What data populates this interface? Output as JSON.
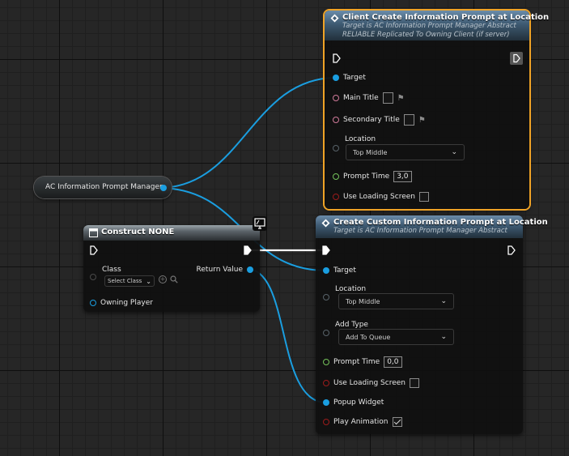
{
  "colors": {
    "object_pin": "#1a9ee0",
    "exec": "#ffffff",
    "selection": "#f0a326",
    "text_pin": "#d07a9a",
    "float_pin": "#74c25a",
    "bool_pin": "#9b1b1b"
  },
  "variable_node": {
    "label": "AC Information Prompt Manager"
  },
  "client_node": {
    "title": "Client Create Information Prompt at Location",
    "subtitle1": "Target is AC Information Prompt Manager Abstract",
    "subtitle2": "RELIABLE Replicated To Owning Client (if server)",
    "pins": {
      "target": "Target",
      "main_title": "Main Title",
      "secondary_title": "Secondary Title",
      "location": "Location",
      "location_value": "Top Middle",
      "prompt_time": "Prompt Time",
      "prompt_time_value": "3,0",
      "use_loading_screen": "Use Loading Screen"
    }
  },
  "construct_node": {
    "title": "Construct NONE",
    "pins": {
      "class": "Class",
      "class_placeholder": "Select Class",
      "return_value": "Return Value",
      "owning_player": "Owning Player"
    }
  },
  "custom_node": {
    "title": "Create Custom Information Prompt at Location",
    "subtitle": "Target is AC Information Prompt Manager Abstract",
    "pins": {
      "target": "Target",
      "location": "Location",
      "location_value": "Top Middle",
      "add_type": "Add Type",
      "add_type_value": "Add To Queue",
      "prompt_time": "Prompt Time",
      "prompt_time_value": "0,0",
      "use_loading_screen": "Use Loading Screen",
      "popup_widget": "Popup Widget",
      "play_animation": "Play Animation"
    },
    "play_animation_checked": true
  },
  "icons": [
    "function-icon",
    "construct-node-icon",
    "monitor-icon",
    "flag-icon",
    "chevron-down-icon",
    "exec-pin-icon",
    "reset-icon",
    "browse-icon",
    "checkmark-icon"
  ]
}
